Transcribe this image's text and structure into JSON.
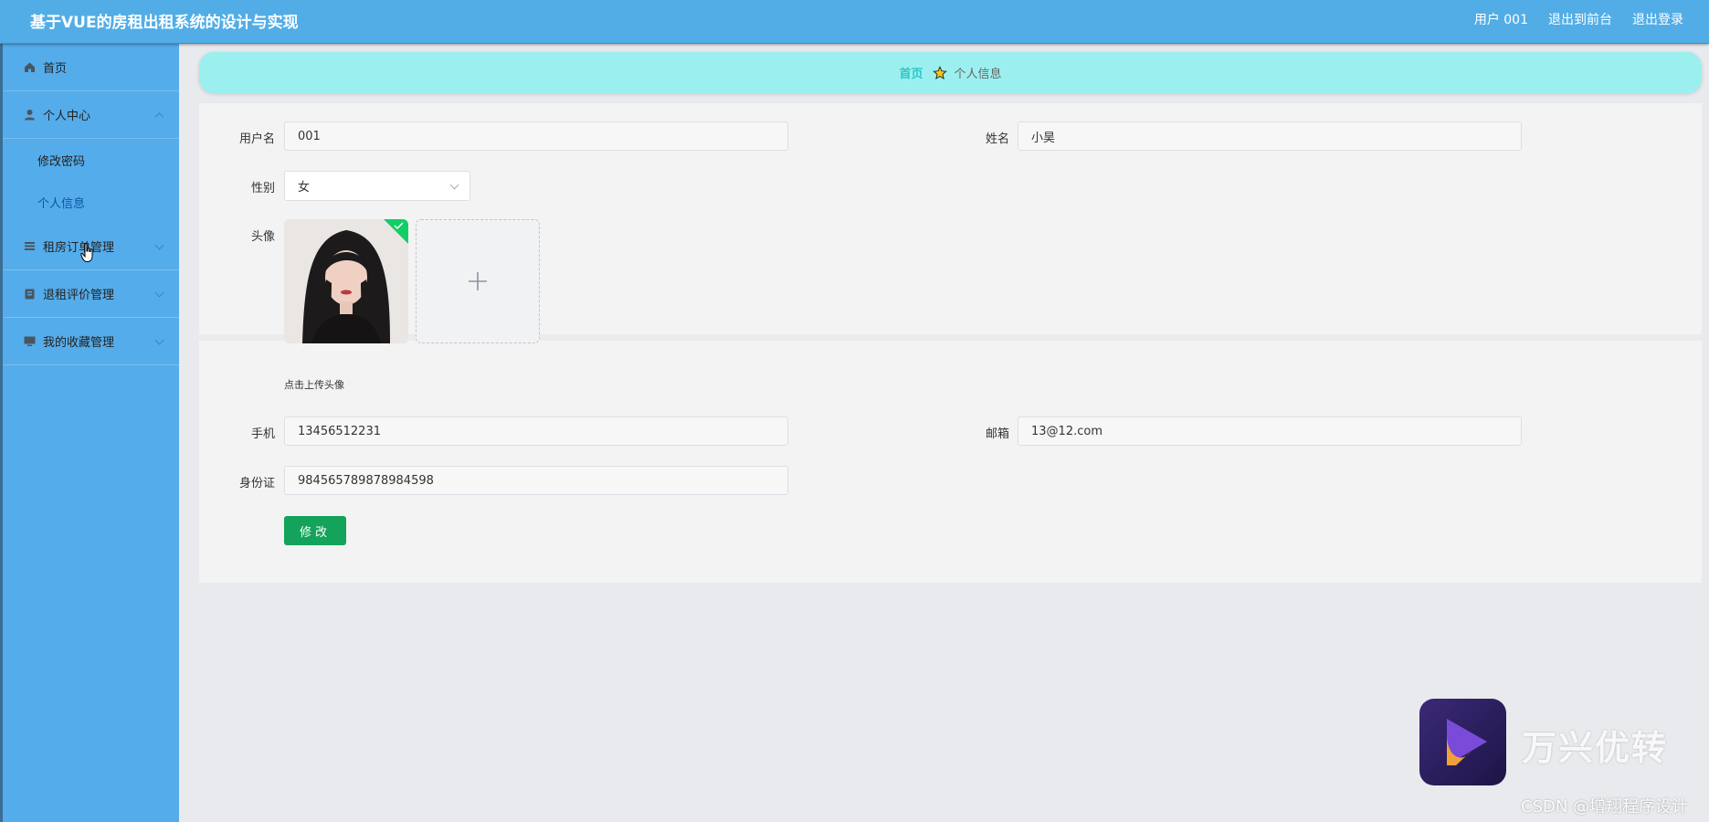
{
  "header": {
    "title": "基于VUE的房租出租系统的设计与实现",
    "user_label": "用户 001",
    "back_to_front": "退出到前台",
    "logout": "退出登录"
  },
  "sidebar": {
    "items": [
      {
        "label": "首页",
        "icon": "home-icon"
      },
      {
        "label": "个人中心",
        "icon": "user-icon",
        "expanded": true,
        "children": [
          {
            "label": "修改密码",
            "active": false
          },
          {
            "label": "个人信息",
            "active": true
          }
        ]
      },
      {
        "label": "租房订单管理",
        "icon": "list-icon"
      },
      {
        "label": "退租评价管理",
        "icon": "clipboard-icon"
      },
      {
        "label": "我的收藏管理",
        "icon": "monitor-icon"
      }
    ]
  },
  "breadcrumb": {
    "home": "首页",
    "current": "个人信息"
  },
  "form": {
    "username_label": "用户名",
    "username_value": "001",
    "name_label": "姓名",
    "name_value": "小昊",
    "gender_label": "性别",
    "gender_value": "女",
    "avatar_label": "头像",
    "avatar_hint": "点击上传头像",
    "phone_label": "手机",
    "phone_value": "13456512231",
    "email_label": "邮箱",
    "email_value": "13@12.com",
    "id_label": "身份证",
    "id_value": "984565789878984598",
    "submit_label": "修改"
  },
  "watermark": {
    "brand": "万兴优转",
    "credit": "CSDN @增翔程序设计"
  },
  "colors": {
    "header_bg": "#52ade6",
    "sidebar_bg": "#55acea",
    "breadcrumb_bg": "#9bf0ef",
    "breadcrumb_home": "#2ec6c6",
    "button_bg": "#13a35a"
  }
}
